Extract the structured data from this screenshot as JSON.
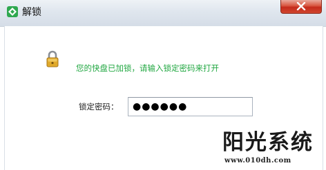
{
  "window": {
    "title": "解锁",
    "close_label": "×"
  },
  "dialog": {
    "message": "您的快盘已加锁，请输入锁定密码来打开",
    "password_label": "锁定密码：",
    "password_value": "●●●●●●"
  },
  "watermark": {
    "title": "阳光系统",
    "url": "www.010dh.com"
  },
  "colors": {
    "message_green": "#23a843",
    "close_red": "#c42b1c",
    "app_icon_green": "#2fa84f"
  }
}
